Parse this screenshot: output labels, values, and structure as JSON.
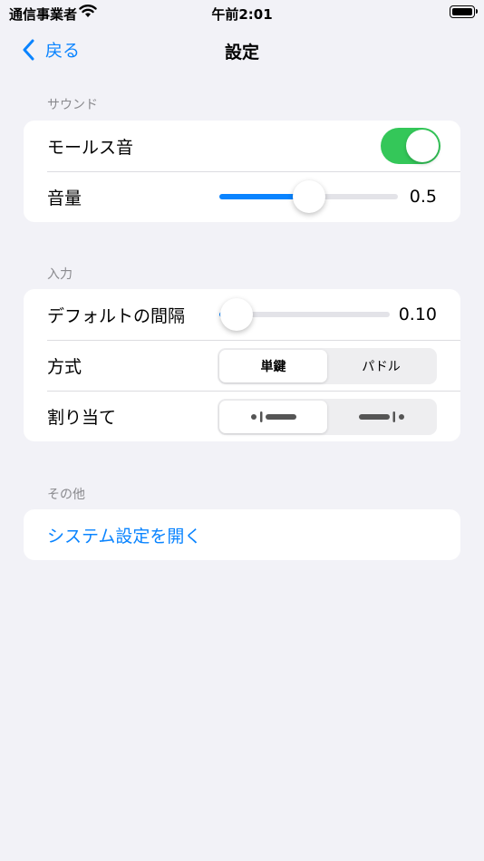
{
  "status_bar": {
    "carrier": "通信事業者",
    "time": "午前2:01"
  },
  "nav": {
    "back_label": "戻る",
    "title": "設定"
  },
  "sound": {
    "header": "サウンド",
    "morse_label": "モールス音",
    "morse_on": true,
    "volume_label": "音量",
    "volume_fraction": 0.5,
    "volume_value": "0.5"
  },
  "input": {
    "header": "入力",
    "interval_label": "デフォルトの間隔",
    "interval_fraction": 0.1,
    "interval_value": "0.10",
    "method_label": "方式",
    "method_options": [
      "単鍵",
      "パドル"
    ],
    "method_selected": 0,
    "assign_label": "割り当て",
    "assign_options": [
      "dot-dash-icon",
      "dash-dot-icon"
    ],
    "assign_selected": 0
  },
  "other": {
    "header": "その他",
    "open_settings": "システム設定を開く"
  },
  "colors": {
    "accent": "#0a84ff",
    "toggle_on": "#34c759",
    "background": "#f2f2f7"
  }
}
